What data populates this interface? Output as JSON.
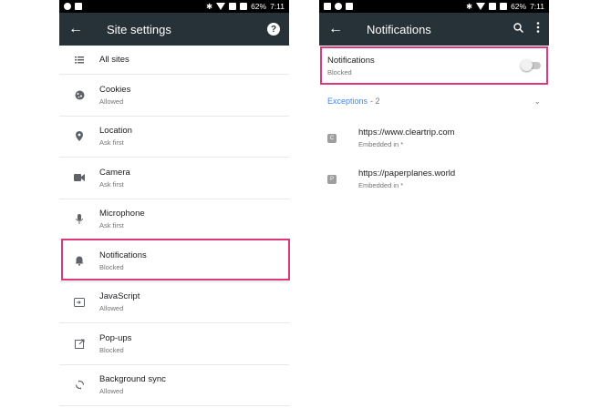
{
  "left": {
    "status": {
      "battery": "62%",
      "time": "7:11"
    },
    "toolbar": {
      "title": "Site settings",
      "back_icon": "arrow-back",
      "help_icon": "help-circle",
      "help_glyph": "?"
    },
    "items": [
      {
        "label": "All sites",
        "sub": "",
        "icon": "list-icon"
      },
      {
        "label": "Cookies",
        "sub": "Allowed",
        "icon": "cookie-icon"
      },
      {
        "label": "Location",
        "sub": "Ask first",
        "icon": "location-icon"
      },
      {
        "label": "Camera",
        "sub": "Ask first",
        "icon": "camera-icon"
      },
      {
        "label": "Microphone",
        "sub": "Ask first",
        "icon": "microphone-icon"
      },
      {
        "label": "Notifications",
        "sub": "Blocked",
        "icon": "bell-icon"
      },
      {
        "label": "JavaScript",
        "sub": "Allowed",
        "icon": "javascript-icon"
      },
      {
        "label": "Pop-ups",
        "sub": "Blocked",
        "icon": "popup-icon"
      },
      {
        "label": "Background sync",
        "sub": "Allowed",
        "icon": "sync-icon"
      }
    ]
  },
  "right": {
    "status": {
      "battery": "62%",
      "time": "7:11"
    },
    "toolbar": {
      "title": "Notifications",
      "back_icon": "arrow-back",
      "search_icon": "search",
      "menu_icon": "more-vert"
    },
    "setting": {
      "label": "Notifications",
      "sub": "Blocked",
      "enabled": false
    },
    "exceptions": {
      "label": "Exceptions",
      "count": "- 2"
    },
    "sites": [
      {
        "url": "https://www.cleartrip.com",
        "sub": "Embedded in *",
        "favicon": "C"
      },
      {
        "url": "https://paperplanes.world",
        "sub": "Embedded in *",
        "favicon": "P"
      }
    ]
  },
  "colors": {
    "highlight": "#e0367a",
    "toolbar": "#263238",
    "accent": "#4285f4"
  }
}
